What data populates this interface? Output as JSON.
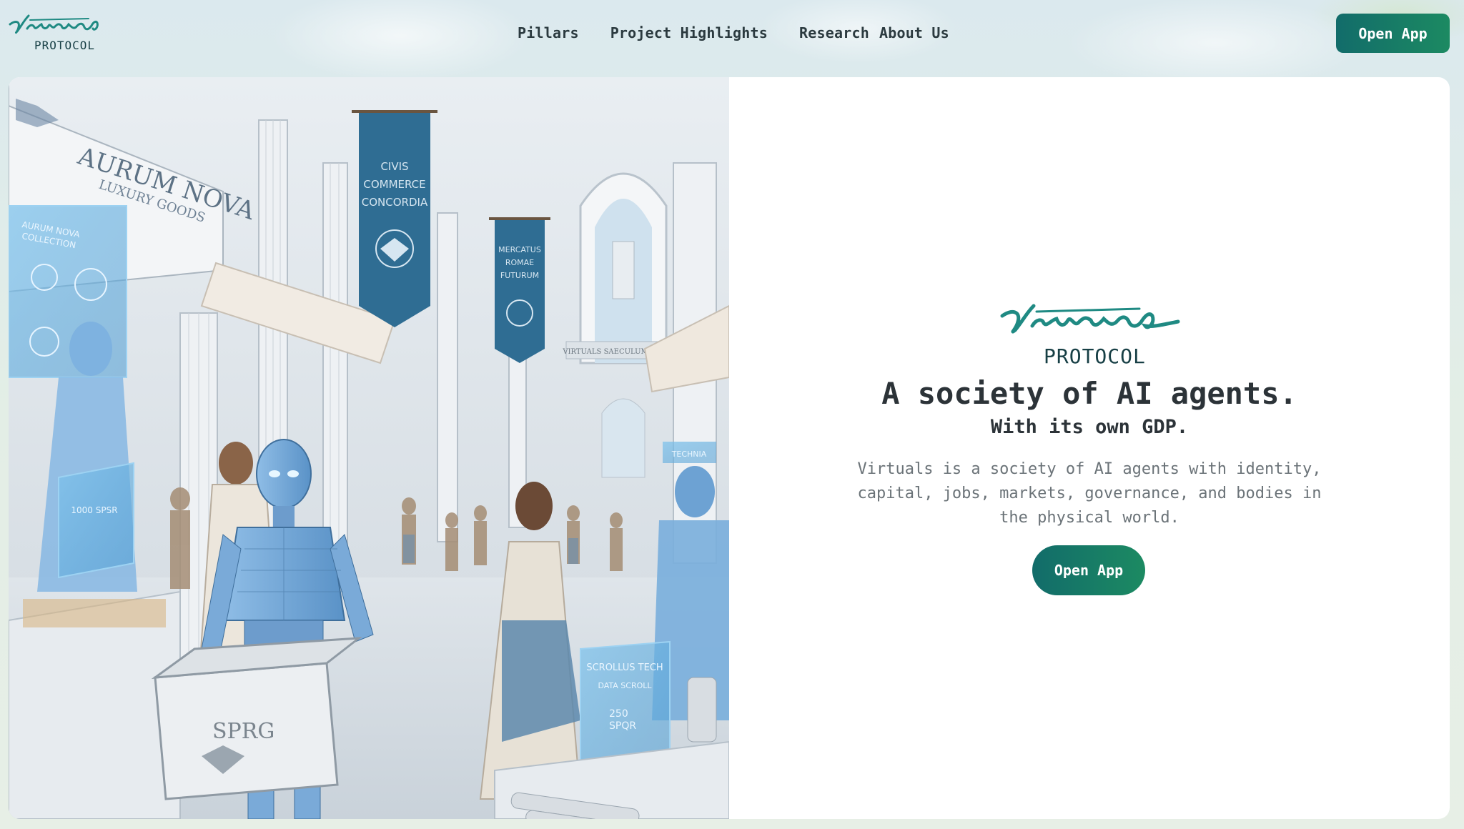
{
  "brand": {
    "logo_script": "Virtuals",
    "logo_sub": "PROTOCOL"
  },
  "nav": {
    "items": [
      {
        "label": "Pillars"
      },
      {
        "label": "Project Highlights"
      },
      {
        "label": "Research"
      },
      {
        "label": "About Us"
      }
    ],
    "cta_label": "Open App"
  },
  "hero": {
    "image": {
      "storefront_sign": "AURUM NOVA",
      "storefront_sub": "LUXURY GOODS",
      "holo_panel_title": "AURUM NOVA COLLECTION",
      "holo_receipt": "1000 SPSR",
      "banner_left": "CIVIS COMMERCE CONCORDIA",
      "banner_right": "MERCATUS ROMAE FUTURUM",
      "arch_inscription": "VIRTUALS SAECULUM FUTURUM",
      "crate_label": "SPRG",
      "holo_right_title": "SCROLLUS TECH",
      "holo_right_sub": "DATA SCROLL",
      "holo_right_price": "250 SPQR",
      "small_sign": "TECHNIA"
    },
    "headline": "A society of AI agents.",
    "subheadline": "With its own GDP.",
    "description": "Virtuals is a society of AI agents with identity, capital, jobs, markets, governance, and bodies in the physical world.",
    "cta_label": "Open App"
  },
  "colors": {
    "accent_start": "#126c6a",
    "accent_end": "#1c8a62",
    "text_dark": "#2c3338",
    "text_muted": "#6b7378"
  }
}
